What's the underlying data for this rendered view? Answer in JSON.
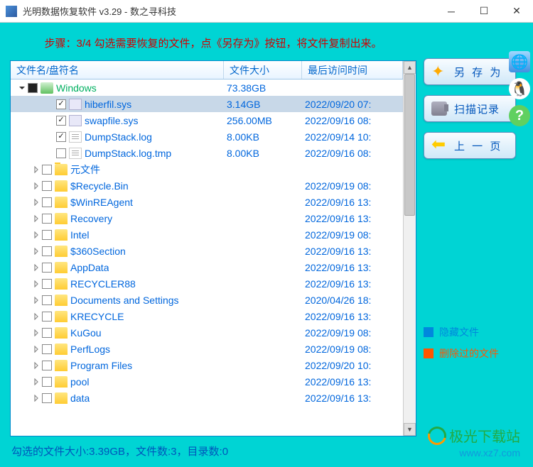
{
  "window": {
    "title": "光明数据恢复软件 v3.29 - 数之寻科技"
  },
  "step_text": "步骤：3/4 勾选需要恢复的文件，点《另存为》按钮，将文件复制出来。",
  "columns": {
    "name": "文件名/盘符名",
    "size": "文件大小",
    "date": "最后访问时间"
  },
  "rows": [
    {
      "depth": 0,
      "expander": "down",
      "check": "mixed",
      "icon": "drive",
      "name": "Windows",
      "color": "green",
      "size": "73.38GB",
      "date": "",
      "selected": false
    },
    {
      "depth": 2,
      "expander": "",
      "check": "checked",
      "icon": "file-sys",
      "name": "hiberfil.sys",
      "color": "blue",
      "size": "3.14GB",
      "date": "2022/09/20 07:",
      "selected": true
    },
    {
      "depth": 2,
      "expander": "",
      "check": "checked",
      "icon": "file-sys",
      "name": "swapfile.sys",
      "color": "blue",
      "size": "256.00MB",
      "date": "2022/09/16 08:",
      "selected": false
    },
    {
      "depth": 2,
      "expander": "",
      "check": "checked",
      "icon": "file-log",
      "name": "DumpStack.log",
      "color": "blue",
      "size": "8.00KB",
      "date": "2022/09/14 10:",
      "selected": false
    },
    {
      "depth": 2,
      "expander": "",
      "check": "",
      "icon": "file-log",
      "name": "DumpStack.log.tmp",
      "color": "blue",
      "size": "8.00KB",
      "date": "2022/09/16 08:",
      "selected": false
    },
    {
      "depth": 1,
      "expander": "right",
      "check": "",
      "icon": "folder",
      "name": "元文件",
      "color": "blue",
      "size": "",
      "date": "",
      "selected": false
    },
    {
      "depth": 1,
      "expander": "right",
      "check": "",
      "icon": "folder",
      "name": "$Recycle.Bin",
      "color": "blue",
      "size": "",
      "date": "2022/09/19 08:",
      "selected": false
    },
    {
      "depth": 1,
      "expander": "right",
      "check": "",
      "icon": "folder",
      "name": "$WinREAgent",
      "color": "blue",
      "size": "",
      "date": "2022/09/16 13:",
      "selected": false
    },
    {
      "depth": 1,
      "expander": "right",
      "check": "",
      "icon": "folder",
      "name": "Recovery",
      "color": "blue",
      "size": "",
      "date": "2022/09/16 13:",
      "selected": false
    },
    {
      "depth": 1,
      "expander": "right",
      "check": "",
      "icon": "folder",
      "name": "Intel",
      "color": "blue",
      "size": "",
      "date": "2022/09/19 08:",
      "selected": false
    },
    {
      "depth": 1,
      "expander": "right",
      "check": "",
      "icon": "folder",
      "name": "$360Section",
      "color": "blue",
      "size": "",
      "date": "2022/09/16 13:",
      "selected": false
    },
    {
      "depth": 1,
      "expander": "right",
      "check": "",
      "icon": "folder",
      "name": "AppData",
      "color": "blue",
      "size": "",
      "date": "2022/09/16 13:",
      "selected": false
    },
    {
      "depth": 1,
      "expander": "right",
      "check": "",
      "icon": "folder",
      "name": "RECYCLER88",
      "color": "blue",
      "size": "",
      "date": "2022/09/16 13:",
      "selected": false
    },
    {
      "depth": 1,
      "expander": "right",
      "check": "",
      "icon": "folder",
      "name": "Documents and Settings",
      "color": "blue",
      "size": "",
      "date": "2020/04/26 18:",
      "selected": false
    },
    {
      "depth": 1,
      "expander": "right",
      "check": "",
      "icon": "folder",
      "name": "KRECYCLE",
      "color": "blue",
      "size": "",
      "date": "2022/09/16 13:",
      "selected": false
    },
    {
      "depth": 1,
      "expander": "right",
      "check": "",
      "icon": "folder",
      "name": "KuGou",
      "color": "blue",
      "size": "",
      "date": "2022/09/19 08:",
      "selected": false
    },
    {
      "depth": 1,
      "expander": "right",
      "check": "",
      "icon": "folder",
      "name": "PerfLogs",
      "color": "blue",
      "size": "",
      "date": "2022/09/19 08:",
      "selected": false
    },
    {
      "depth": 1,
      "expander": "right",
      "check": "",
      "icon": "folder",
      "name": "Program Files",
      "color": "blue",
      "size": "",
      "date": "2022/09/20 10:",
      "selected": false
    },
    {
      "depth": 1,
      "expander": "right",
      "check": "",
      "icon": "folder",
      "name": "pool",
      "color": "blue",
      "size": "",
      "date": "2022/09/16 13:",
      "selected": false
    },
    {
      "depth": 1,
      "expander": "right",
      "check": "",
      "icon": "folder",
      "name": "data",
      "color": "blue",
      "size": "",
      "date": "2022/09/16 13:",
      "selected": false
    }
  ],
  "buttons": {
    "save_as": "另 存 为",
    "scan_log": "扫描记录",
    "prev_page": "上 一 页"
  },
  "legend": {
    "hidden": "隐藏文件",
    "deleted": "删除过的文件"
  },
  "status": "勾选的文件大小:3.39GB，文件数:3，目录数:0",
  "watermark": {
    "name": "极光下载站",
    "url": "www.xz7.com"
  }
}
